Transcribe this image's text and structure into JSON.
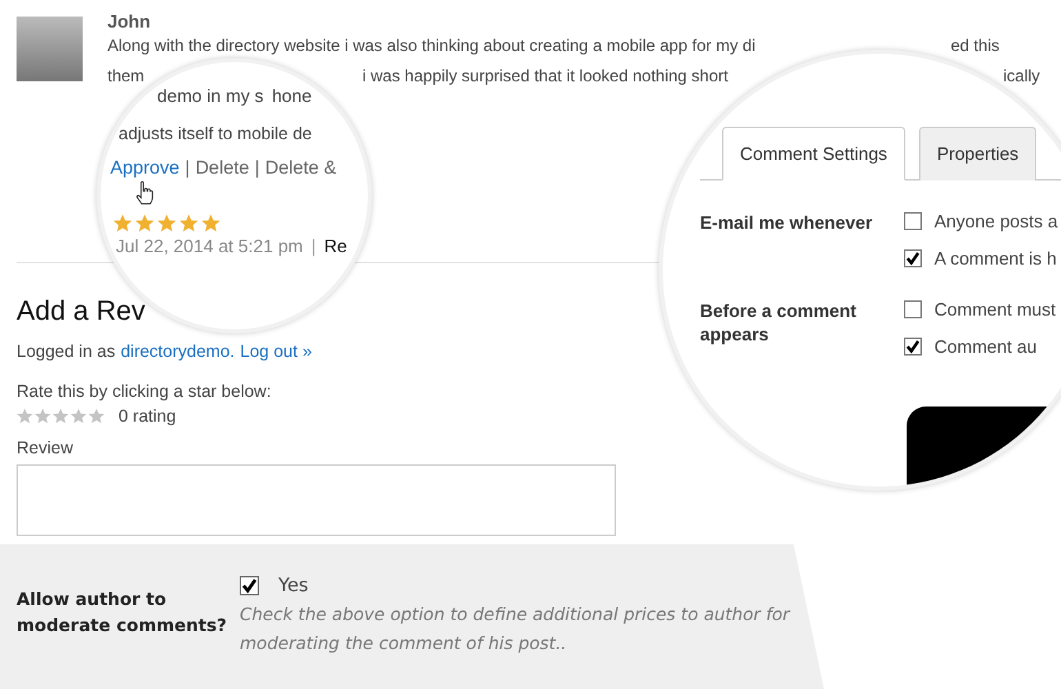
{
  "comment": {
    "author": "John",
    "lines": [
      [
        "Along with the directory website i was also thinking about creating a mobile app for my di",
        "ed this"
      ],
      [
        "them",
        "i was happily surprised that it looked nothing short",
        "ically"
      ]
    ]
  },
  "magnifier_left": {
    "lines": [
      [
        "demo in my s",
        "hone"
      ],
      [
        "adjusts itself to mobile de"
      ]
    ],
    "actions": [
      {
        "label": "Approve",
        "kind": "link"
      },
      {
        "label": "|",
        "kind": "separator"
      },
      {
        "label": "Delete",
        "kind": "action"
      },
      {
        "label": "|",
        "kind": "separator"
      },
      {
        "label": "Delete &",
        "kind": "action"
      }
    ],
    "stars": 5,
    "date": "Jul 22, 2014 at 5:21 pm",
    "separator": "|",
    "reply": "Re"
  },
  "magnifier_right": {
    "tabs": [
      {
        "label": "Comment Settings",
        "selected": true
      },
      {
        "label": "Properties",
        "selected": false
      }
    ],
    "groups": [
      {
        "label": "E-mail me whenever",
        "options": [
          {
            "label": "Anyone posts a",
            "checked": false
          },
          {
            "label": "A comment is h",
            "checked": true
          }
        ]
      },
      {
        "label": "Before a comment appears",
        "options": [
          {
            "label": "Comment must",
            "checked": false
          },
          {
            "label": "Comment au",
            "checked": true
          }
        ]
      }
    ]
  },
  "review_form": {
    "title": "Add a Rev",
    "logged_in": "Logged in as",
    "user": "directorydemo.",
    "logout": "Log out »",
    "rate_prompt": "Rate this by clicking a star below:",
    "stars": 0,
    "rating": "0 rating",
    "review_label": "Review"
  },
  "author_option": {
    "label": "Allow author to moderate comments?",
    "checked": true,
    "option": "Yes",
    "hint": "Check the above option to define additional prices to author for moderating the comment of his post.."
  }
}
